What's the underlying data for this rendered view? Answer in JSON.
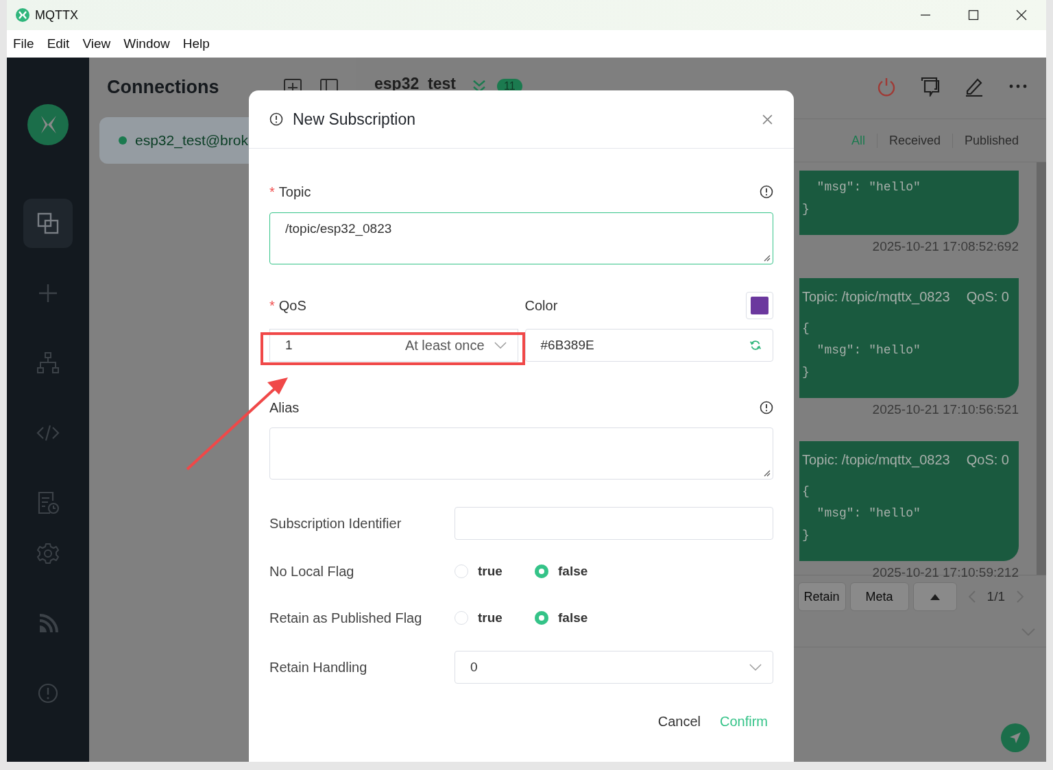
{
  "window": {
    "title": "MQTTX"
  },
  "menu": [
    "File",
    "Edit",
    "View",
    "Window",
    "Help"
  ],
  "sidebar": {
    "items": [
      {
        "kind": "connections",
        "selected": true
      },
      {
        "kind": "new",
        "selected": false
      },
      {
        "kind": "topology",
        "selected": false
      },
      {
        "kind": "script",
        "selected": false
      },
      {
        "kind": "log",
        "selected": false
      },
      {
        "kind": "settings",
        "selected": false
      },
      {
        "kind": "feed",
        "selected": false
      },
      {
        "kind": "about",
        "selected": false
      }
    ]
  },
  "connections": {
    "title": "Connections",
    "items": [
      {
        "name": "esp32_test@brok",
        "connected": true,
        "selected": true
      }
    ]
  },
  "chat": {
    "title": "esp32_test",
    "count": "11",
    "filters": [
      {
        "label": "All",
        "selected": true
      },
      {
        "label": "Received",
        "selected": false
      },
      {
        "label": "Published",
        "selected": false
      }
    ],
    "messages": [
      {
        "lines": [
          "  \"msg\": \"hello\"",
          "}"
        ],
        "time": "2025-10-21 17:08:52:692"
      },
      {
        "topic": "Topic: /topic/mqttx_0823",
        "qos": "QoS: 0",
        "lines": [
          "{",
          "  \"msg\": \"hello\"",
          "}"
        ],
        "time": "2025-10-21 17:10:56:521"
      },
      {
        "topic": "Topic: /topic/mqttx_0823",
        "qos": "QoS: 0",
        "lines": [
          "{",
          "  \"msg\": \"hello\"",
          "}"
        ],
        "time": "2025-10-21 17:10:59:212"
      }
    ],
    "toolbar": {
      "buttons": [
        "Retain",
        "Meta"
      ],
      "page": "1/1"
    }
  },
  "dialog": {
    "title": "New Subscription",
    "topic": {
      "label": "Topic",
      "required_mark": "*",
      "value": "/topic/esp32_0823"
    },
    "qos": {
      "label": "QoS",
      "required_mark": "*",
      "value": "1",
      "description": "At least once"
    },
    "color": {
      "label": "Color",
      "value": "#6B389E"
    },
    "alias": {
      "label": "Alias"
    },
    "subscription_identifier": {
      "label": "Subscription Identifier"
    },
    "flags": [
      {
        "label": "No Local Flag",
        "options": [
          {
            "label": "true",
            "selected": false
          },
          {
            "label": "false",
            "selected": true
          }
        ]
      },
      {
        "label": "Retain as Published Flag",
        "options": [
          {
            "label": "true",
            "selected": false
          },
          {
            "label": "false",
            "selected": true
          }
        ]
      }
    ],
    "retain_handling": {
      "label": "Retain Handling",
      "value": "0"
    },
    "buttons": [
      {
        "label": "Cancel",
        "kind": "secondary"
      },
      {
        "label": "Confirm",
        "kind": "primary"
      }
    ]
  }
}
